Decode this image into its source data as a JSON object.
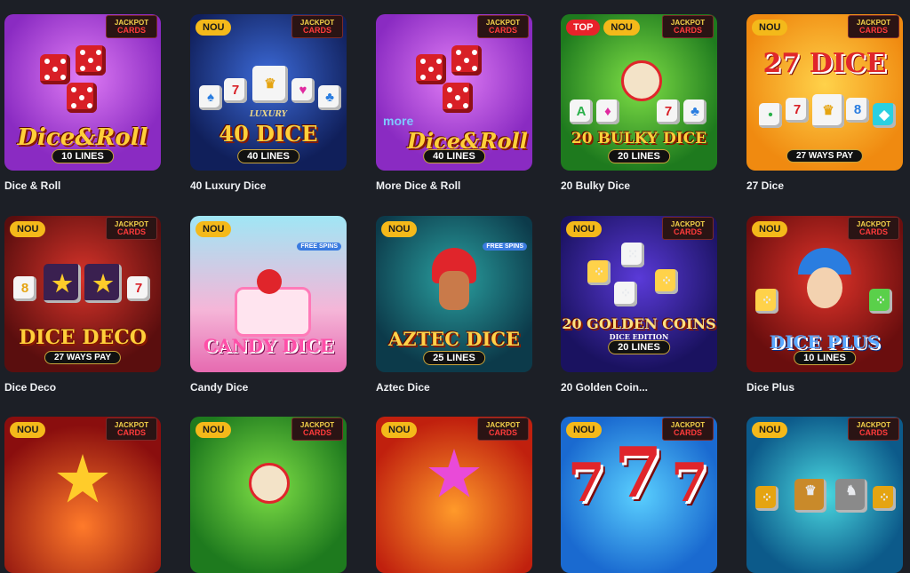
{
  "games": [
    {
      "title": "Dice & Roll",
      "badges": [],
      "jackpot": true,
      "art": {
        "main": "Dice&Roll",
        "sub": "10 LINES"
      }
    },
    {
      "title": "40 Luxury Dice",
      "badges": [
        "NOU"
      ],
      "jackpot": true,
      "art": {
        "main": "40 DICE",
        "tag": "LUXURY",
        "sub": "40 LINES"
      }
    },
    {
      "title": "More Dice & Roll",
      "badges": [],
      "jackpot": true,
      "art": {
        "pre": "more",
        "main": "Dice&Roll",
        "sub": "40 LINES"
      }
    },
    {
      "title": "20 Bulky Dice",
      "badges": [
        "TOP",
        "NOU"
      ],
      "jackpot": true,
      "art": {
        "main": "20 BULKY DICE",
        "sub": "20 LINES"
      }
    },
    {
      "title": "27 Dice",
      "badges": [
        "NOU"
      ],
      "jackpot": true,
      "art": {
        "main": "27 DICE",
        "sub": "27 WAYS PAY"
      }
    },
    {
      "title": "Dice Deco",
      "badges": [
        "NOU"
      ],
      "jackpot": true,
      "art": {
        "main": "DICE DECO",
        "sub": "27 WAYS PAY"
      }
    },
    {
      "title": "Candy Dice",
      "badges": [
        "NOU"
      ],
      "jackpot": false,
      "free_spins": "FREE SPINS",
      "art": {
        "main": "CANDY DICE"
      }
    },
    {
      "title": "Aztec Dice",
      "badges": [
        "NOU"
      ],
      "jackpot": false,
      "free_spins": "FREE SPINS",
      "art": {
        "main": "AZTEC DICE",
        "sub": "25 LINES"
      }
    },
    {
      "title": "20 Golden Coin...",
      "badges": [
        "NOU"
      ],
      "jackpot": true,
      "art": {
        "main": "20 GOLDEN COINS",
        "tag": "DICE EDITION",
        "sub": "20 LINES"
      }
    },
    {
      "title": "Dice Plus",
      "badges": [
        "NOU"
      ],
      "jackpot": true,
      "art": {
        "main": "DICE PLUS",
        "sub": "10 LINES"
      }
    },
    {
      "title": "",
      "badges": [
        "NOU"
      ],
      "jackpot": true
    },
    {
      "title": "",
      "badges": [
        "NOU"
      ],
      "jackpot": true
    },
    {
      "title": "",
      "badges": [
        "NOU"
      ],
      "jackpot": true
    },
    {
      "title": "",
      "badges": [
        "NOU"
      ],
      "jackpot": true
    },
    {
      "title": "",
      "badges": [
        "NOU"
      ],
      "jackpot": true
    }
  ],
  "jackpot_label": {
    "line1": "JACKPOT",
    "line2": "CARDS"
  },
  "colors": {
    "background": "#1c1f26",
    "nou_badge": "#f4b91a",
    "top_badge": "#e8222a"
  }
}
